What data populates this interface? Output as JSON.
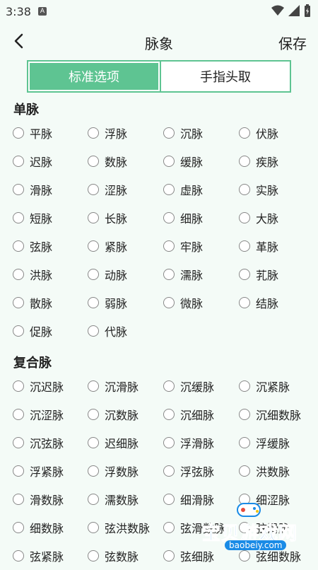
{
  "status": {
    "time": "3:38",
    "notif": "A"
  },
  "toolbar": {
    "title": "脉象",
    "save_label": "保存"
  },
  "tabs": [
    {
      "label": "标准选项",
      "active": true
    },
    {
      "label": "手指头取",
      "active": false
    }
  ],
  "sections": [
    {
      "title": "单脉",
      "options": [
        "平脉",
        "浮脉",
        "沉脉",
        "伏脉",
        "迟脉",
        "数脉",
        "缓脉",
        "疾脉",
        "滑脉",
        "涩脉",
        "虚脉",
        "实脉",
        "短脉",
        "长脉",
        "细脉",
        "大脉",
        "弦脉",
        "紧脉",
        "牢脉",
        "革脉",
        "洪脉",
        "动脉",
        "濡脉",
        "芤脉",
        "散脉",
        "弱脉",
        "微脉",
        "结脉",
        "促脉",
        "代脉"
      ]
    },
    {
      "title": "复合脉",
      "options": [
        "沉迟脉",
        "沉滑脉",
        "沉缓脉",
        "沉紧脉",
        "沉涩脉",
        "沉数脉",
        "沉细脉",
        "沉细数脉",
        "沉弦脉",
        "迟细脉",
        "浮滑脉",
        "浮缓脉",
        "浮紧脉",
        "浮数脉",
        "浮弦脉",
        "洪数脉",
        "滑数脉",
        "濡数脉",
        "细滑脉",
        "细涩脉",
        "细数脉",
        "弦洪数脉",
        "弦滑数脉",
        "弦滑脉",
        "弦紧脉",
        "弦数脉",
        "弦细脉",
        "弦细数脉"
      ]
    }
  ],
  "watermark": {
    "text": "宝贝游戏网",
    "url": "baobeiy.com"
  },
  "colors": {
    "accent": "#5ec492",
    "background": "#f4fbf7"
  }
}
